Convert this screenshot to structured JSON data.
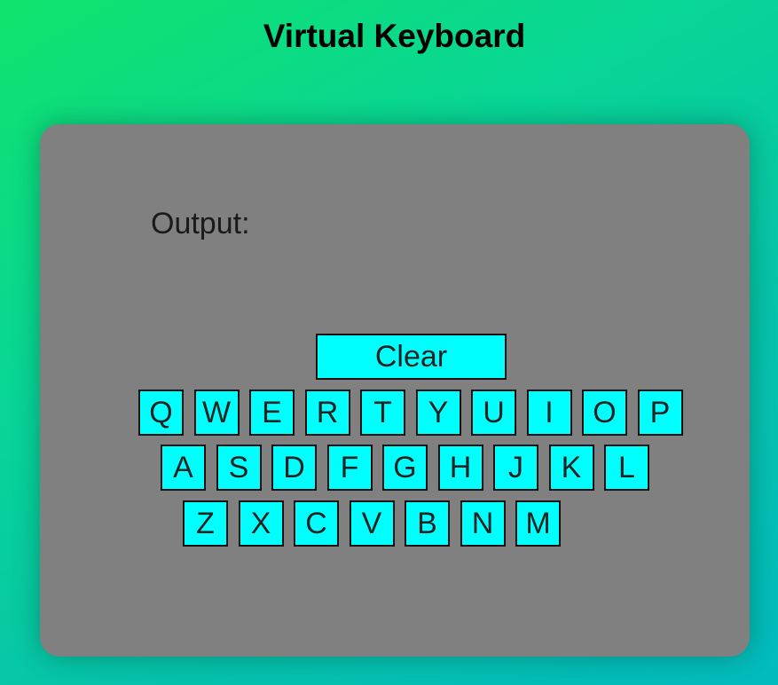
{
  "header": {
    "title": "Virtual Keyboard"
  },
  "panel": {
    "output_label": "Output:",
    "output_value": "",
    "clear_label": "Clear"
  },
  "keyboard": {
    "rows": [
      [
        "Q",
        "W",
        "E",
        "R",
        "T",
        "Y",
        "U",
        "I",
        "O",
        "P"
      ],
      [
        "A",
        "S",
        "D",
        "F",
        "G",
        "H",
        "J",
        "K",
        "L"
      ],
      [
        "Z",
        "X",
        "C",
        "V",
        "B",
        "N",
        "M"
      ]
    ]
  },
  "colors": {
    "key_background": "#00ffff",
    "panel_background": "#808080",
    "gradient_start": "#10e36c",
    "gradient_end": "#02bbbf"
  }
}
